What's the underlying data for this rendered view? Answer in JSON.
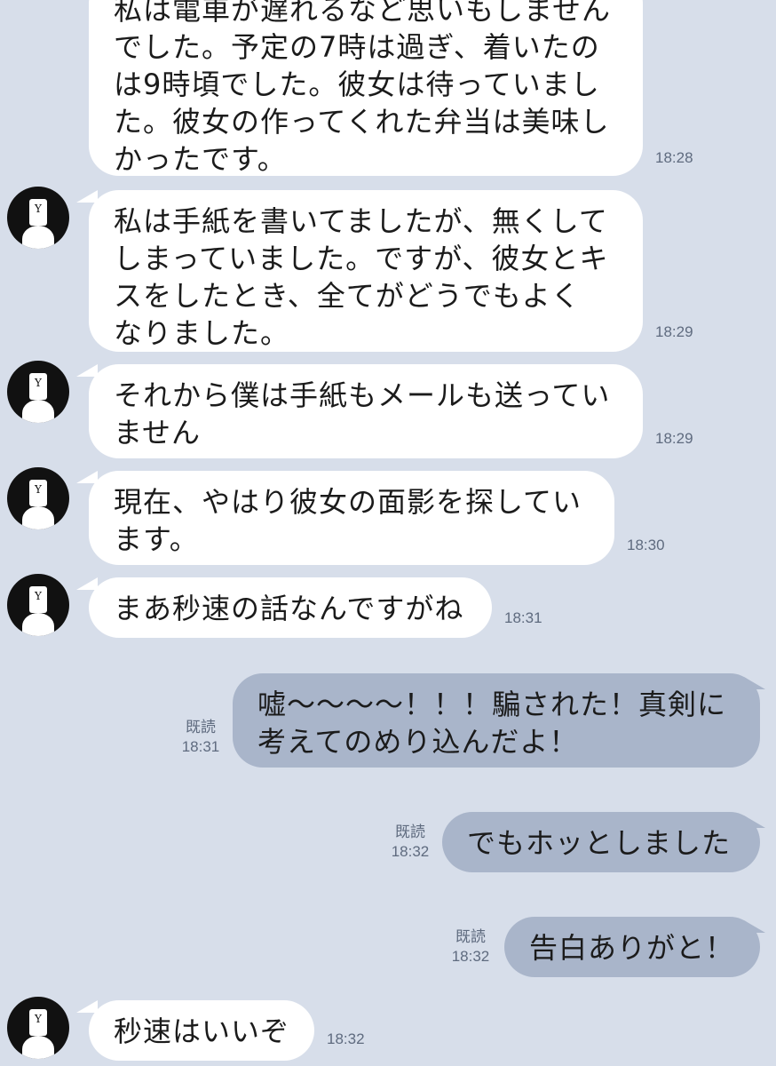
{
  "messages": [
    {
      "id": 1,
      "from": "friend",
      "text": "私は電車が遅れるなど思いもしませんでした。予定の7時は過ぎ、着いたのは9時頃でした。彼女は待っていました。彼女の作ってくれた弁当は美味しかったです。",
      "display_text": "私は電車が遅れるなど思いもしません\nでした。予定の7時は過ぎ、着いたの\nは9時頃でした。彼女は待っていまし\nた。彼女の作ってくれた弁当は美味し\nかったです。",
      "time": "18:28"
    },
    {
      "id": 2,
      "from": "friend",
      "text": "私は手紙を書いてましたが、無くしてしまっていました。ですが、彼女とキスをしたとき、全てがどうでもよくなりました。",
      "display_text": "私は手紙を書いてましたが、無くして\nしまっていました。ですが、彼女とキ\nスをしたとき、全てがどうでもよく\nなりました。",
      "time": "18:29"
    },
    {
      "id": 3,
      "from": "friend",
      "text": "それから僕は手紙もメールも送っていません",
      "display_text": "それから僕は手紙もメールも送ってい\nません",
      "time": "18:29"
    },
    {
      "id": 4,
      "from": "friend",
      "text": "現在、やはり彼女の面影を探しています。",
      "display_text": "現在、やはり彼女の面影を探してい\nます。",
      "time": "18:30"
    },
    {
      "id": 5,
      "from": "friend",
      "text": "まあ秒速の話なんですがね",
      "display_text": "まあ秒速の話なんですがね",
      "time": "18:31"
    },
    {
      "id": 6,
      "from": "me",
      "text": "嘘〜〜〜〜！！！騙された！真剣に考えてのめり込んだよ！",
      "display_text": "嘘〜〜〜〜！！！騙された！真剣に\n考えてのめり込んだよ！",
      "time": "18:31",
      "read_label": "既読"
    },
    {
      "id": 7,
      "from": "me",
      "text": "でもホッとしました",
      "display_text": "でもホッとしました",
      "time": "18:32",
      "read_label": "既読"
    },
    {
      "id": 8,
      "from": "me",
      "text": "告白ありがと！",
      "display_text": "告白ありがと！",
      "time": "18:32",
      "read_label": "既読"
    },
    {
      "id": 9,
      "from": "friend",
      "text": "秒速はいいぞ",
      "display_text": "秒速はいいぞ",
      "time": "18:32"
    }
  ],
  "avatar": {
    "letter": "Y"
  },
  "colors": {
    "background": "#d7deea",
    "incoming_bubble": "#ffffff",
    "outgoing_bubble": "#a9b5ca",
    "meta_text": "#5f6b7f"
  }
}
